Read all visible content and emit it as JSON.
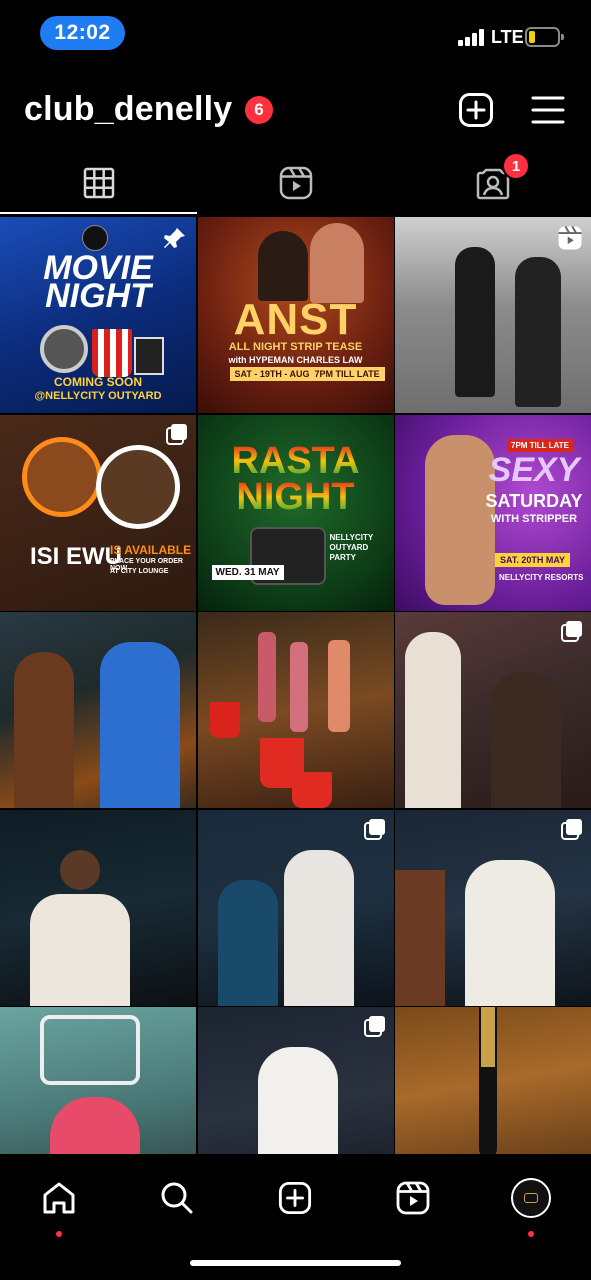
{
  "status": {
    "time": "12:02",
    "network": "LTE",
    "battery_color": "#f6d000"
  },
  "header": {
    "username": "club_denelly",
    "notification_count": "6"
  },
  "tabs": {
    "tagged_badge": "1"
  },
  "posts": [
    {
      "line1": "MOVIE",
      "line2": "NIGHT",
      "line3": "COMING SOON",
      "line4": "@NELLYCITY OUTYARD",
      "pinned": true
    },
    {
      "line1": "ANST",
      "line2": "ALL NIGHT STRIP TEASE",
      "line3": "with HYPEMAN CHARLES LAW",
      "line4": "SAT - 19TH - AUG",
      "line5": "7PM TILL LATE"
    },
    {
      "type": "reel"
    },
    {
      "line1": "ISI EWU",
      "line2": "IS AVAILABLE",
      "line3": "PLACE YOUR ORDER NOW",
      "line4": "AT CITY LOUNGE",
      "carousel": true
    },
    {
      "line1": "RASTA",
      "line2": "NIGHT",
      "line3": "NELLYCITY OUTYARD PARTY",
      "line4": "WED. 31 MAY"
    },
    {
      "line1": "7PM TILL LATE",
      "line2": "SEXY",
      "line3": "SATURDAY",
      "line4": "WITH STRIPPER",
      "line5": "SAT. 20TH MAY",
      "line6": "NELLYCITY RESORTS"
    },
    {
      "type": "photo"
    },
    {
      "type": "photo"
    },
    {
      "type": "photo",
      "carousel": true
    },
    {
      "type": "photo"
    },
    {
      "type": "photo",
      "carousel": true
    },
    {
      "type": "photo",
      "carousel": true
    },
    {
      "type": "photo"
    },
    {
      "type": "photo",
      "carousel": true
    },
    {
      "type": "photo"
    }
  ],
  "icons": {
    "header": [
      "plus-square-icon",
      "menu-icon"
    ],
    "tabs": [
      "grid-icon",
      "reels-icon",
      "tagged-icon"
    ],
    "nav": [
      "home-icon",
      "search-icon",
      "create-icon",
      "reels-icon",
      "profile-avatar"
    ]
  },
  "colors": {
    "badge": "#ff3040",
    "time_pill": "#1f7cf2"
  }
}
